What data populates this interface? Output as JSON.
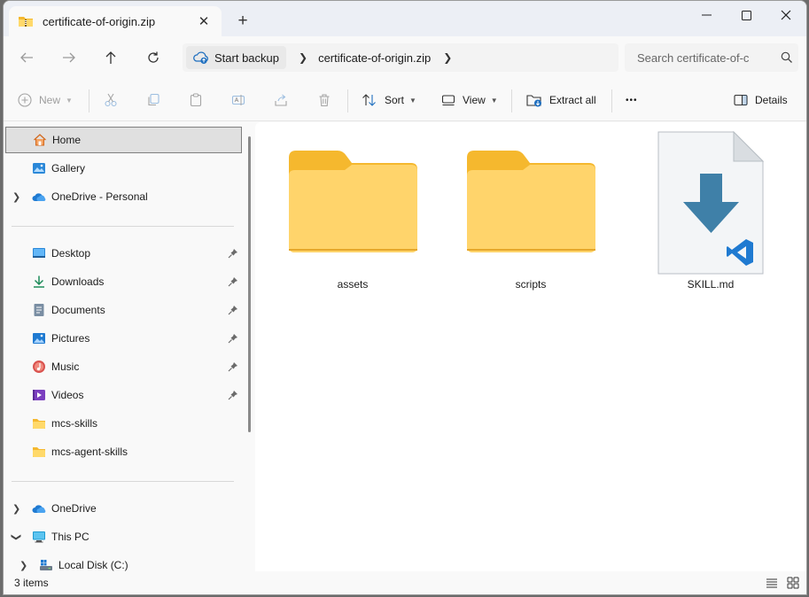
{
  "window": {
    "tab_title": "certificate-of-origin.zip",
    "tab_icon": "zip-folder-icon",
    "new_tab_label": "+"
  },
  "address": {
    "backup_label": "Start backup",
    "path": [
      "certificate-of-origin.zip"
    ],
    "search_placeholder": "Search certificate-of-c"
  },
  "commands": {
    "new": "New",
    "sort": "Sort",
    "view": "View",
    "extract_all": "Extract all",
    "more": "•••",
    "details": "Details"
  },
  "sidebar": {
    "home": "Home",
    "gallery": "Gallery",
    "onedrive_personal": "OneDrive - Personal",
    "quick": [
      {
        "label": "Desktop",
        "icon": "desktop-icon"
      },
      {
        "label": "Downloads",
        "icon": "downloads-icon"
      },
      {
        "label": "Documents",
        "icon": "documents-icon"
      },
      {
        "label": "Pictures",
        "icon": "pictures-icon"
      },
      {
        "label": "Music",
        "icon": "music-icon"
      },
      {
        "label": "Videos",
        "icon": "videos-icon"
      },
      {
        "label": "mcs-skills",
        "icon": "folder-icon"
      },
      {
        "label": "mcs-agent-skills",
        "icon": "folder-icon"
      }
    ],
    "onedrive": "OneDrive",
    "this_pc": "This PC",
    "local_disk": "Local Disk (C:)"
  },
  "files": [
    {
      "name": "assets",
      "type": "folder"
    },
    {
      "name": "scripts",
      "type": "folder"
    },
    {
      "name": "SKILL.md",
      "type": "markdown-file"
    }
  ],
  "status": {
    "count": "3 items"
  },
  "colors": {
    "folder_back": "#f5b82e",
    "folder_front": "#ffd96a",
    "vscode_blue": "#1f7ad1",
    "arrow_blue": "#3d7fa6"
  }
}
